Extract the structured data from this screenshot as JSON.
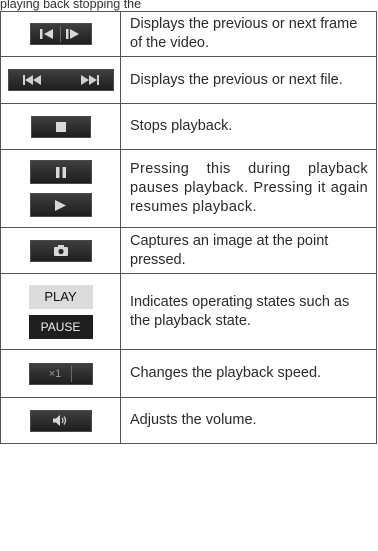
{
  "header_fragment": "playing back stopping the",
  "rows": [
    {
      "icon": "frame-step-icon",
      "description": "Displays the previous or next frame of the video."
    },
    {
      "icon": "skip-file-icon",
      "description": "Displays the previous or next file."
    },
    {
      "icon": "stop-icon",
      "description": "Stops playback."
    },
    {
      "icon": "pause-play-icon",
      "description": "Pressing this during playback pauses playback. Pressing it again resumes playback."
    },
    {
      "icon": "camera-icon",
      "description": "Captures an image at the point pressed."
    },
    {
      "icon": "play-pause-state-icon",
      "description": "Indicates operating states such as the playback state.",
      "labels": {
        "play": "PLAY",
        "pause": "PAUSE"
      }
    },
    {
      "icon": "speed-icon",
      "description": "Changes the playback speed.",
      "speed_label": "×1"
    },
    {
      "icon": "volume-icon",
      "description": "Adjusts the volume."
    }
  ]
}
